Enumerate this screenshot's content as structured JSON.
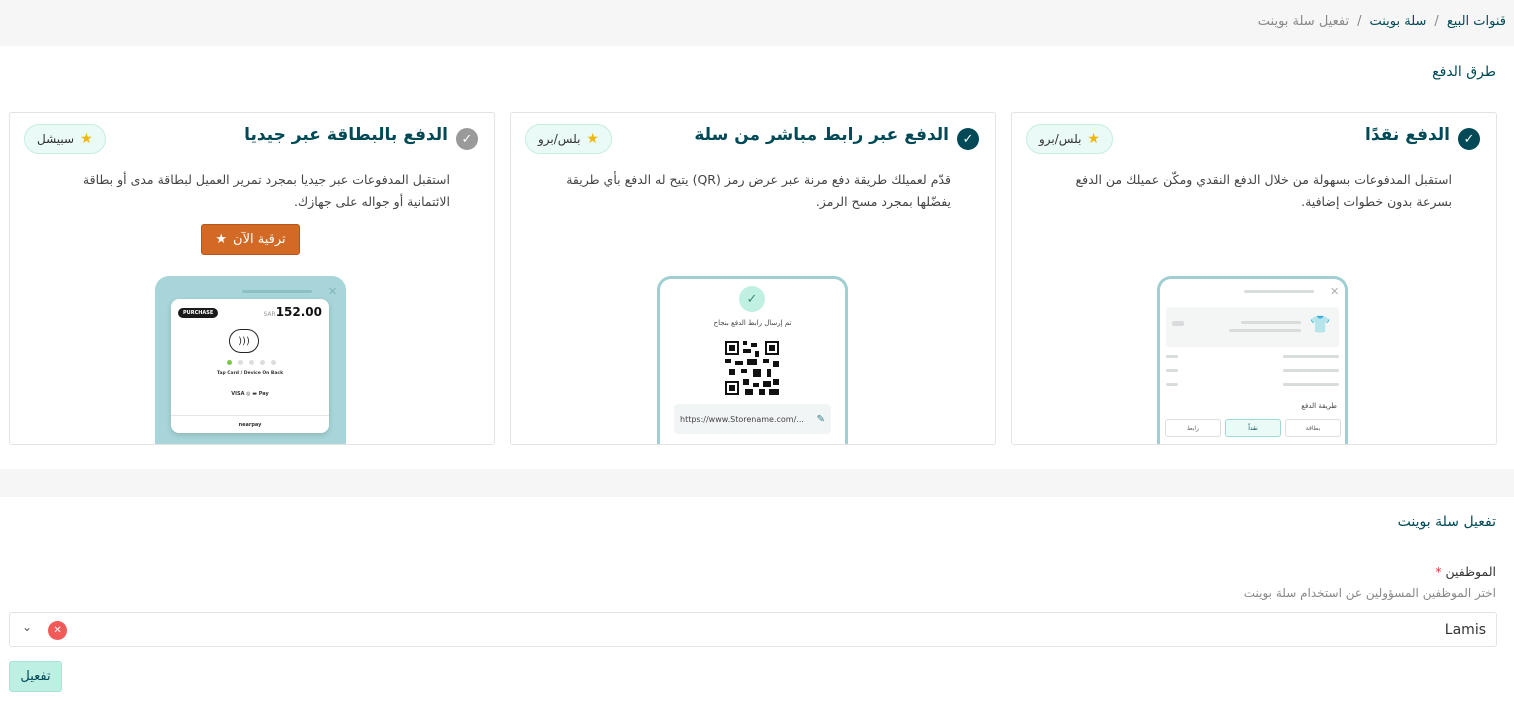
{
  "breadcrumb": {
    "items": [
      "قنوات البيع",
      "سلة بوينت"
    ],
    "current": "تفعيل سلة بوينت",
    "separator": "/"
  },
  "payment_methods": {
    "title": "طرق الدفع",
    "cards": [
      {
        "title": "الدفع نقدًا",
        "badge": "بلس/برو",
        "description": "استقبل المدفوعات بسهولة من خلال الدفع النقدي ومكّن عميلك من الدفع بسرعة بدون خطوات إضافية.",
        "checked": true,
        "mock": {
          "section_label": "طريقة الدفع",
          "tabs": [
            "بطاقة",
            "نقداً",
            "رابط"
          ],
          "active_tab": "نقداً"
        }
      },
      {
        "title": "الدفع عبر رابط مباشر من سلة",
        "badge": "بلس/برو",
        "description": "قدّم لعميلك طريقة دفع مرنة عبر عرض رمز (QR) يتيح له الدفع بأي طريقة يفضّلها بمجرد مسح الرمز.",
        "checked": true,
        "mock": {
          "success_text": "تم إرسال رابط الدفع بنجاح",
          "url": "https://www.Storename.com/..."
        }
      },
      {
        "title": "الدفع بالبطاقة عبر جيديا",
        "badge": "سبيشل",
        "description": "استقبل المدفوعات عبر جيديا بمجرد تمرير العميل لبطاقة مدى أو بطاقة الائتمانية أو جواله على جهازك.",
        "checked": false,
        "upgrade_label": "ترقية الآن",
        "mock": {
          "badge": "PURCHASE",
          "currency": "SAR",
          "amount": "152.00",
          "tap_text": "Tap Card / Device On Back",
          "logos": "VISA  ◎  ▬  Pay",
          "powered": "nearpay"
        }
      }
    ]
  },
  "activation": {
    "title": "تفعيل سلة بوينت",
    "field_label": "الموظفين",
    "required_mark": "*",
    "hint": "اختر الموظفين المسؤولين عن استخدام سلة بوينت",
    "selected_value": "Lamis",
    "submit_label": "تفعيل"
  },
  "colors": {
    "primary": "#004956",
    "upgrade": "#d26a26",
    "badge_bg": "#eafaf6",
    "activate_bg": "#bdf0e3",
    "clear": "#f25a5a"
  },
  "icons": {
    "check": "check-circle-icon",
    "star": "star-icon",
    "clear": "close-circle-icon",
    "chevron": "chevron-down-icon"
  }
}
